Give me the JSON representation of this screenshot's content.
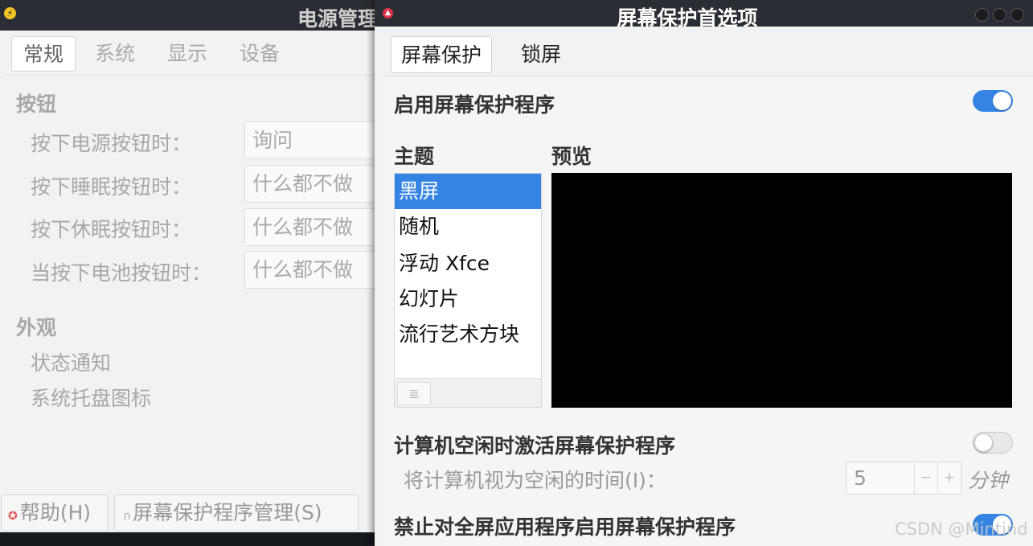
{
  "power_manager": {
    "title": "电源管理",
    "tabs": [
      "常规",
      "系统",
      "显示",
      "设备"
    ],
    "section_buttons": "按钮",
    "rows": [
      {
        "label": "按下电源按钮时：",
        "value": "询问"
      },
      {
        "label": "按下睡眠按钮时：",
        "value": "什么都不做"
      },
      {
        "label": "按下休眠按钮时：",
        "value": "什么都不做"
      },
      {
        "label": "当按下电池按钮时：",
        "value": "什么都不做"
      }
    ],
    "section_appearance": "外观",
    "appearance_items": [
      "状态通知",
      "系统托盘图标"
    ],
    "help_button": "帮助(H)",
    "screensaver_manager_button": "屏幕保护程序管理(S)"
  },
  "screensaver": {
    "title": "屏幕保护首选项",
    "tabs": [
      "屏幕保护",
      "锁屏"
    ],
    "enable_label": "启用屏幕保护程序",
    "enable_on": true,
    "theme_heading": "主题",
    "preview_heading": "预览",
    "themes": [
      "黑屏",
      "随机",
      "浮动 Xfce",
      "幻灯片",
      "流行艺术方块"
    ],
    "selected_theme": "黑屏",
    "idle_activate_label": "计算机空闲时激活屏幕保护程序",
    "idle_activate_on": false,
    "idle_time_label": "将计算机视为空闲的时间(I)：",
    "idle_time_value": "5",
    "idle_time_unit": "分钟",
    "fullscreen_inhibit_label": "禁止对全屏应用程序启用屏幕保护程序",
    "fullscreen_inhibit_on": true,
    "accent_color": "#3584e4"
  },
  "watermark": "CSDN @Mintind"
}
